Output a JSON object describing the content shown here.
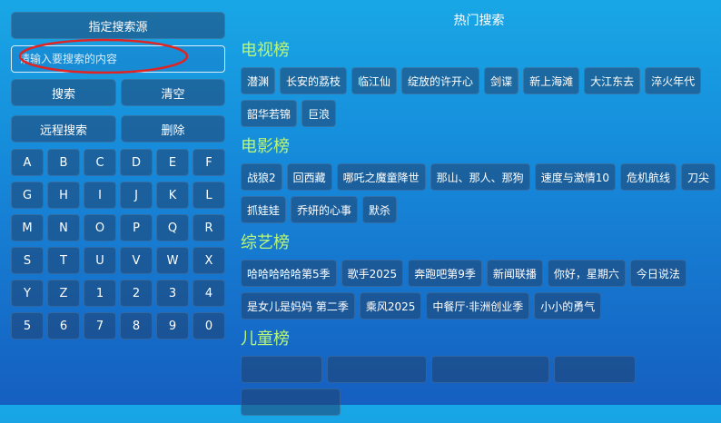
{
  "left": {
    "source_label": "指定搜索源",
    "search_placeholder": "请输入要搜索的内容",
    "search_label": "搜索",
    "clear_label": "清空",
    "remote_search_label": "远程搜索",
    "delete_label": "删除",
    "keys": [
      "A",
      "B",
      "C",
      "D",
      "E",
      "F",
      "G",
      "H",
      "I",
      "J",
      "K",
      "L",
      "M",
      "N",
      "O",
      "P",
      "Q",
      "R",
      "S",
      "T",
      "U",
      "V",
      "W",
      "X",
      "Y",
      "Z",
      "1",
      "2",
      "3",
      "4",
      "5",
      "6",
      "7",
      "8",
      "9",
      "0"
    ]
  },
  "annotation_color": "#e02424",
  "hot": {
    "title": "热门搜索",
    "sections": [
      {
        "name": "电视榜",
        "items": [
          "潜渊",
          "长安的荔枝",
          "临江仙",
          "绽放的许开心",
          "剑谍",
          "新上海滩",
          "大江东去",
          "淬火年代",
          "韶华若锦",
          "巨浪"
        ]
      },
      {
        "name": "电影榜",
        "items": [
          "战狼2",
          "回西藏",
          "哪吒之魔童降世",
          "那山、那人、那狗",
          "速度与激情10",
          "危机航线",
          "刀尖",
          "抓娃娃",
          "乔妍的心事",
          "默杀"
        ]
      },
      {
        "name": "综艺榜",
        "items": [
          "哈哈哈哈哈第5季",
          "歌手2025",
          "奔跑吧第9季",
          "新闻联播",
          "你好，星期六",
          "今日说法",
          "是女儿是妈妈 第二季",
          "乘风2025",
          "中餐厅·非洲创业季",
          "小小的勇气"
        ]
      },
      {
        "name": "儿童榜",
        "items": [
          "",
          "",
          "",
          "",
          ""
        ]
      }
    ]
  }
}
